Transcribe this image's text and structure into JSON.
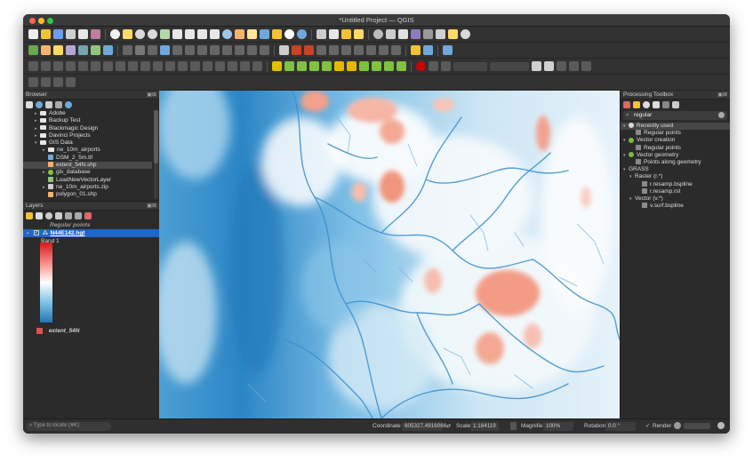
{
  "window": {
    "title": "*Untitled Project — QGIS"
  },
  "browser": {
    "title": "Browser",
    "items": [
      {
        "label": "Adobe",
        "indent": 1,
        "type": "folder"
      },
      {
        "label": "Backup Test",
        "indent": 1,
        "type": "folder"
      },
      {
        "label": "Blackmagic Design",
        "indent": 1,
        "type": "folder"
      },
      {
        "label": "Davinci Projects",
        "indent": 1,
        "type": "folder"
      },
      {
        "label": "GIS Data",
        "indent": 1,
        "type": "folder-open"
      },
      {
        "label": "ne_10m_airports",
        "indent": 2,
        "type": "folder"
      },
      {
        "label": "DSM_2_5m.tif",
        "indent": 2,
        "type": "raster"
      },
      {
        "label": "extent_54N.shp",
        "indent": 2,
        "type": "vector",
        "selected": true
      },
      {
        "label": "gis_database",
        "indent": 2,
        "type": "db"
      },
      {
        "label": "LoadNewVectorLayer",
        "indent": 2,
        "type": "script"
      },
      {
        "label": "ne_10m_airports.zip",
        "indent": 2,
        "type": "zip"
      },
      {
        "label": "polygon_01.shp",
        "indent": 2,
        "type": "vector"
      }
    ]
  },
  "layers": {
    "title": "Layers",
    "regular_points": "Regular points",
    "active_layer": "N44E142.hgt",
    "band_label": "Band 1",
    "extent_layer": "extent_54N",
    "extent_color": "#d9534f"
  },
  "processing": {
    "title": "Processing Toolbox",
    "search_value": "regular",
    "tree": [
      {
        "label": "Recently used",
        "indent": 0,
        "icon": "clock",
        "selected": true
      },
      {
        "label": "Regular points",
        "indent": 2,
        "icon": "alg"
      },
      {
        "label": "Vector creation",
        "indent": 0,
        "icon": "gear"
      },
      {
        "label": "Regular points",
        "indent": 2,
        "icon": "alg"
      },
      {
        "label": "Vector geometry",
        "indent": 0,
        "icon": "gear"
      },
      {
        "label": "Points along geometry",
        "indent": 2,
        "icon": "alg"
      },
      {
        "label": "GRASS",
        "indent": 0,
        "icon": "none"
      },
      {
        "label": "Raster (r.*)",
        "indent": 1,
        "icon": "none"
      },
      {
        "label": "r.resamp.bspline",
        "indent": 3,
        "icon": "alg"
      },
      {
        "label": "r.resamp.rst",
        "indent": 3,
        "icon": "alg"
      },
      {
        "label": "Vector (v.*)",
        "indent": 1,
        "icon": "none"
      },
      {
        "label": "v.surf.bspline",
        "indent": 3,
        "icon": "alg"
      }
    ]
  },
  "statusbar": {
    "locate_placeholder": "Type to locate (⌘K)",
    "coordinate_label": "Coordinate",
    "coordinate_value": "605327,4916066",
    "scale_label": "Scale",
    "scale_value": "1:184119",
    "magnifier_label": "Magnifier",
    "magnifier_value": "100%",
    "rotation_label": "Rotation",
    "rotation_value": "0.0 °",
    "render_label": "Render"
  },
  "colors": {
    "high": "#e9836b",
    "mid": "#ffffff",
    "low": "#2680c6",
    "selection": "#1f66c8"
  }
}
